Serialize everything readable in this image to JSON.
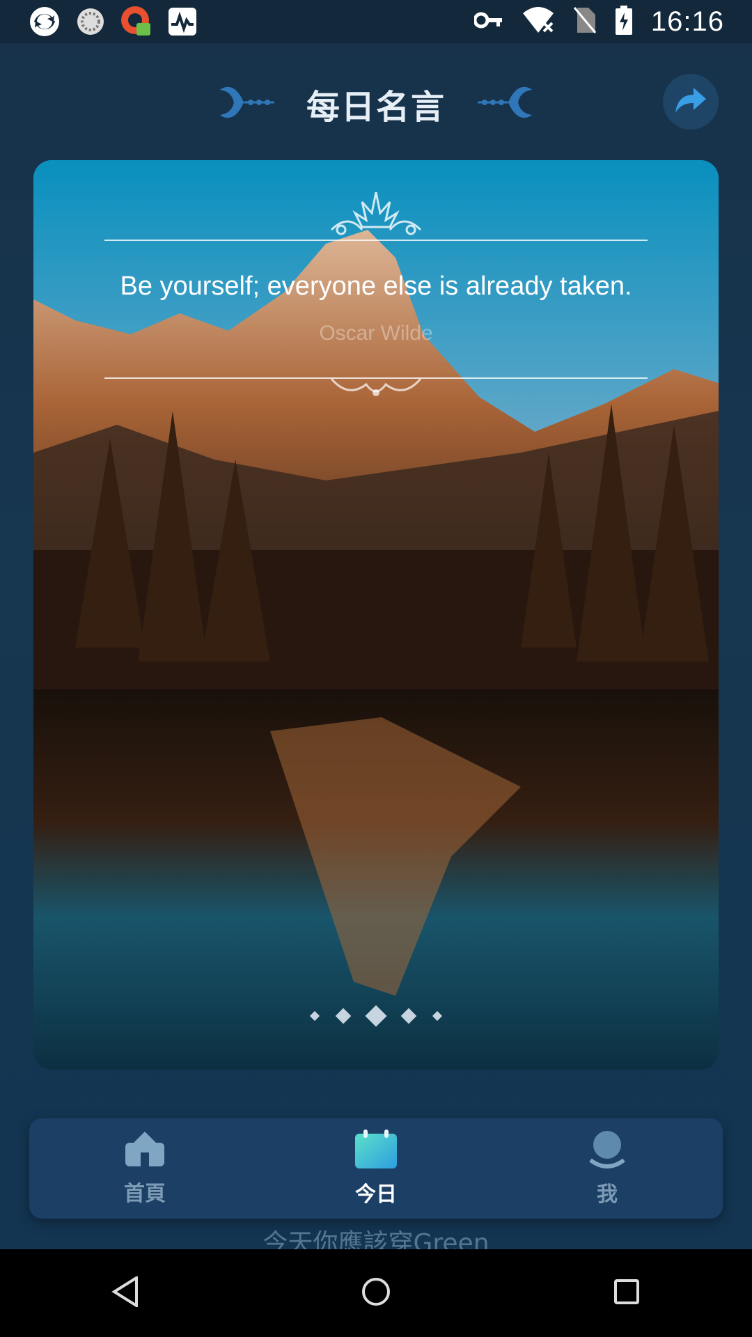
{
  "status_bar": {
    "time": "16:16",
    "left_icons": [
      "sync-app-icon",
      "loading-app-icon",
      "vpn-app-icon",
      "activity-app-icon"
    ],
    "right_icons": [
      "vpn-key-icon",
      "wifi-off-icon",
      "no-sim-icon",
      "battery-charging-icon"
    ]
  },
  "header": {
    "title": "每日名言",
    "share_icon": "share-icon"
  },
  "card": {
    "quote": "Be yourself; everyone else is already taken.",
    "author": "Oscar Wilde",
    "page_dots": 5,
    "active_dot": 3
  },
  "bottom_nav": {
    "items": [
      {
        "label": "首頁",
        "icon": "home-icon",
        "active": false
      },
      {
        "label": "今日",
        "icon": "calendar-icon",
        "active": true
      },
      {
        "label": "我",
        "icon": "profile-icon",
        "active": false
      }
    ]
  },
  "subtitle": "今天你應該穿Green",
  "colors": {
    "background": "#17324a",
    "nav_background": "#1c3f66",
    "accent": "#40d8c8"
  }
}
